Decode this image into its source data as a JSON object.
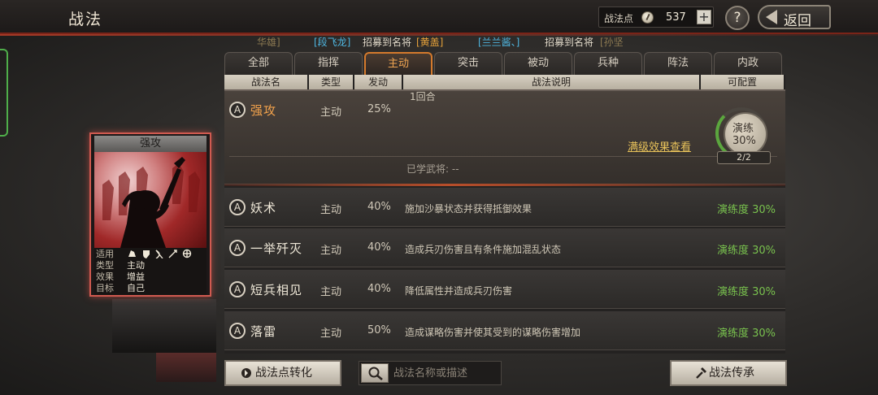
{
  "header": {
    "title": "战法",
    "points_label": "战法点",
    "points_value": "537",
    "plus": "+",
    "help": "?",
    "back_label": "返回"
  },
  "ticker": [
    {
      "text": "华雄]",
      "color": "#8d7a52"
    },
    {
      "text": "[段飞龙]",
      "color": "#4fb6e0"
    },
    {
      "text": "招募到名将",
      "color": "#e0d8c8"
    },
    {
      "text": "[黄盖]",
      "color": "#e6a23a"
    },
    {
      "text": "[兰兰酱、]",
      "color": "#4fb6e0"
    },
    {
      "text": "招募到名将",
      "color": "#e0d8c8"
    },
    {
      "text": "[孙坚",
      "color": "#8d7a52"
    }
  ],
  "tabs": [
    "全部",
    "指挥",
    "主动",
    "突击",
    "被动",
    "兵种",
    "阵法",
    "内政"
  ],
  "active_tab": 2,
  "table": {
    "headers": [
      "战法名",
      "类型",
      "发动",
      "战法说明",
      "可配置"
    ],
    "expanded": {
      "icon": "A",
      "name": "强攻",
      "type": "主动",
      "rate": "25%",
      "desc": "1回合",
      "max_effect_link": "满级效果查看",
      "learned": "已学武将:  --",
      "badge_line1": "演练",
      "badge_line2": "30%",
      "badge_count": "2/2",
      "progress": 0.3
    },
    "rows": [
      {
        "icon": "A",
        "name": "妖术",
        "type": "主动",
        "rate": "40%",
        "desc": "施加沙暴状态并获得抵御效果",
        "proficiency": "演练度 30%"
      },
      {
        "icon": "A",
        "name": "一举歼灭",
        "type": "主动",
        "rate": "40%",
        "desc": "造成兵刃伤害且有条件施加混乱状态",
        "proficiency": "演练度 30%"
      },
      {
        "icon": "A",
        "name": "短兵相见",
        "type": "主动",
        "rate": "40%",
        "desc": "降低属性并造成兵刃伤害",
        "proficiency": "演练度 30%"
      },
      {
        "icon": "A",
        "name": "落雷",
        "type": "主动",
        "rate": "50%",
        "desc": "造成谋略伤害并使其受到的谋略伤害增加",
        "proficiency": "演练度 30%"
      }
    ]
  },
  "card": {
    "title": "强攻",
    "stats": [
      {
        "k": "适用",
        "v": "",
        "icons": [
          "cavalry-icon",
          "shield-icon",
          "bow-icon",
          "spear-icon",
          "wheel-icon"
        ]
      },
      {
        "k": "类型",
        "v": "主动"
      },
      {
        "k": "效果",
        "v": "增益"
      },
      {
        "k": "目标",
        "v": "自己"
      }
    ]
  },
  "bottom": {
    "convert_label": "战法点转化",
    "search_placeholder": "战法名称或描述",
    "inherit_label": "战法传承"
  },
  "colors": {
    "accent_orange": "#f0a552",
    "proficiency_green": "#79c24e",
    "link_gold": "#e8c25a",
    "card_border": "#d05a50"
  }
}
